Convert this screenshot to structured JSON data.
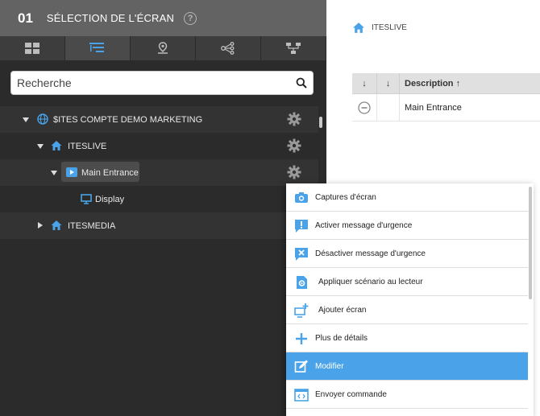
{
  "header": {
    "step_number": "01",
    "title": "SÉLECTION DE L'ÉCRAN",
    "help_label": "?"
  },
  "tabs": [
    {
      "icon": "grid-icon",
      "active": false
    },
    {
      "icon": "tree-list-icon",
      "active": true
    },
    {
      "icon": "location-pin-icon",
      "active": false
    },
    {
      "icon": "share-nodes-icon",
      "active": false
    },
    {
      "icon": "hierarchy-icon",
      "active": false
    }
  ],
  "search": {
    "placeholder": "Recherche",
    "value": ""
  },
  "tree": {
    "items": [
      {
        "label": "$ITES COMPTE DEMO MARKETING",
        "icon": "globe-icon",
        "expanded": true
      },
      {
        "label": "ITESLIVE",
        "icon": "home-icon",
        "expanded": true
      },
      {
        "label": "Main Entrance",
        "icon": "player-icon",
        "expanded": true,
        "selected": true
      },
      {
        "label": "Display",
        "icon": "monitor-icon"
      },
      {
        "label": "ITESMEDIA",
        "icon": "home-icon",
        "expanded": false
      }
    ]
  },
  "breadcrumb": {
    "label": "ITESLIVE"
  },
  "table": {
    "columns": [
      "↓",
      "↓",
      "Description ↑"
    ],
    "rows": [
      {
        "status_icon": "minus-circle-icon",
        "description": "Main Entrance"
      }
    ]
  },
  "context_menu": {
    "items": [
      {
        "label": "Captures d'écran",
        "icon": "camera-icon"
      },
      {
        "label": "Activer message d'urgence",
        "icon": "alert-message-icon"
      },
      {
        "label": "Désactiver message d'urgence",
        "icon": "cancel-message-icon"
      },
      {
        "label": "Appliquer scénario au lecteur",
        "icon": "scenario-icon"
      },
      {
        "label": "Ajouter écran",
        "icon": "add-screen-icon"
      },
      {
        "label": "Plus de détails",
        "icon": "plus-icon"
      },
      {
        "label": "Modifier",
        "icon": "edit-icon",
        "active": true
      },
      {
        "label": "Envoyer commande",
        "icon": "code-icon"
      }
    ]
  },
  "colors": {
    "accent": "#4aa3e8",
    "panel_dark": "#2b2b2b",
    "header_gray": "#636363",
    "tree_icon_blue": "#4aa3e8"
  }
}
